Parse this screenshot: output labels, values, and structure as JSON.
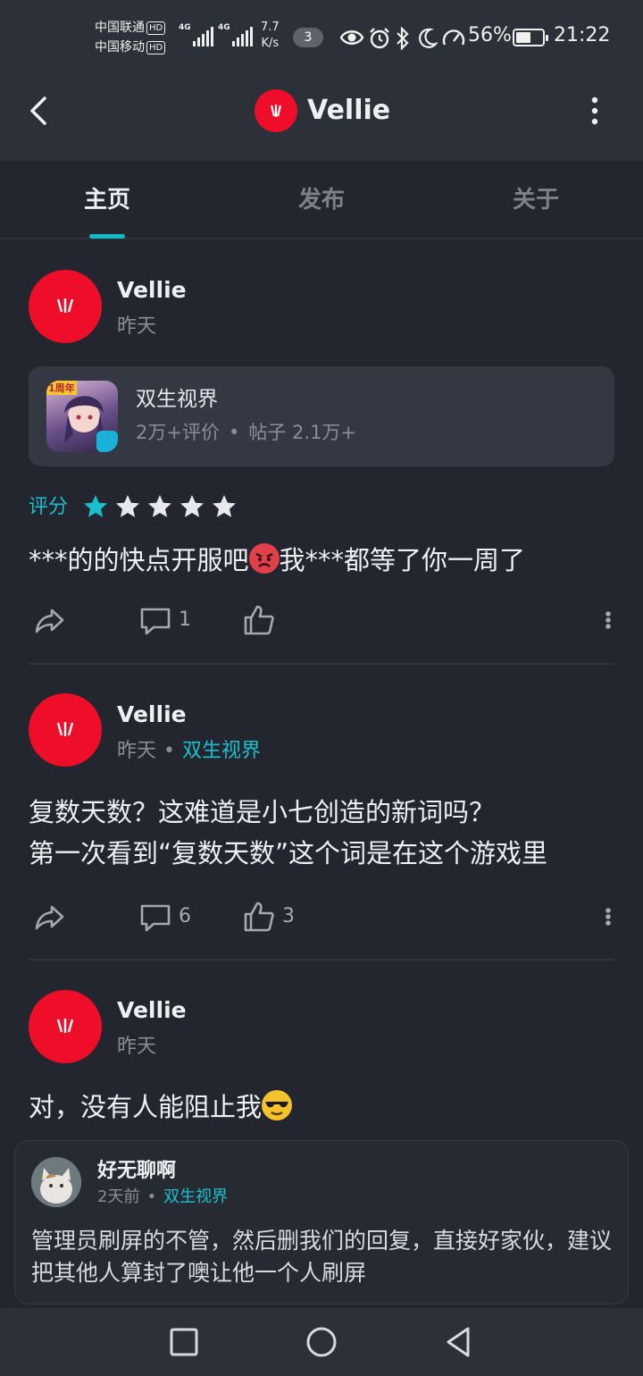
{
  "status_bar": {
    "carrier_1": "中国联通",
    "carrier_2": "中国移动",
    "hd_badge": "HD",
    "net_type_1": "4G",
    "net_type_2": "4G",
    "speed_value": "7.7",
    "speed_unit": "K/s",
    "notification_count": "3",
    "battery_percent": "56%",
    "battery_level": 0.56,
    "time": "21:22",
    "icons": [
      "eye-icon",
      "alarm-icon",
      "bluetooth-icon",
      "moon-icon",
      "speedometer-icon"
    ]
  },
  "header": {
    "title": "Vellie",
    "back_icon": "chevron-left-icon",
    "more_icon": "more-vertical-icon"
  },
  "tabs": [
    {
      "label": "主页",
      "active": true
    },
    {
      "label": "发布",
      "active": false
    },
    {
      "label": "关于",
      "active": false
    }
  ],
  "posts": [
    {
      "author": "Vellie",
      "time": "昨天",
      "game_card": {
        "name": "双生视界",
        "reviews": "2万+评价",
        "posts": "帖子 2.1万+",
        "icon_badge": "1周年"
      },
      "rating": {
        "label": "评分",
        "stars": 1,
        "max": 5
      },
      "text_before_emoji": "***的的快点开服吧",
      "text_after_emoji": "我***都等了你一周了",
      "comments": "1",
      "likes": ""
    },
    {
      "author": "Vellie",
      "time": "昨天",
      "forum": "双生视界",
      "text_line_1": "复数天数？这难道是小七创造的新词吗？",
      "text_line_2": "第一次看到“复数天数”这个词是在这个游戏里",
      "comments": "6",
      "likes": "3"
    },
    {
      "author": "Vellie",
      "time": "昨天",
      "text_before_emoji": "对，没有人能阻止我",
      "reply": {
        "author": "好无聊啊",
        "time": "2天前",
        "forum": "双生视界",
        "text": "管理员刷屏的不管，然后删我们的回复，直接好家伙，建议把其他人算封了噢让他一个人刷屏"
      }
    }
  ],
  "nav_bar": {
    "icons": [
      "recents-square-icon",
      "home-circle-icon",
      "back-triangle-icon"
    ]
  },
  "colors": {
    "accent": "#19c0cc",
    "brand_red": "#ee0e2a",
    "background": "#23262f",
    "header": "#2c3039"
  }
}
